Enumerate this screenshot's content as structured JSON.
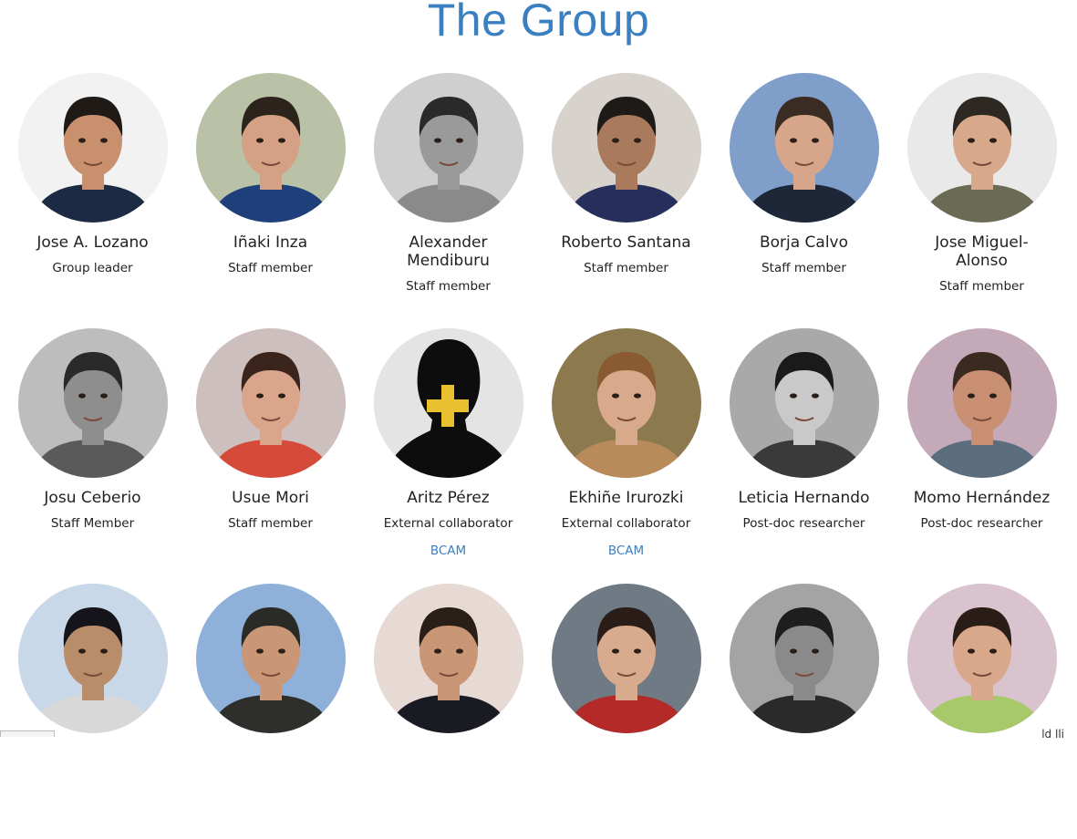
{
  "page": {
    "title": "The Group",
    "accent": "#3a7fc0"
  },
  "members": [
    {
      "name": "Jose A. Lozano",
      "role": "Group leader",
      "bg": "#f2f2f2",
      "skin": "#c9906e",
      "hair": "#1f1a16",
      "shirt": "#1d2a44"
    },
    {
      "name": "Iñaki Inza",
      "role": "Staff member",
      "bg": "#b9c2a6",
      "skin": "#d4a184",
      "hair": "#2c241c",
      "shirt": "#1f3f7a"
    },
    {
      "name": "Alexander Mendiburu",
      "role": "Staff member",
      "bg": "#cfcfcf",
      "skin": "#9a9a9a",
      "hair": "#2a2a2a",
      "shirt": "#8a8a8a"
    },
    {
      "name": "Roberto Santana",
      "role": "Staff member",
      "bg": "#d7d2cc",
      "skin": "#a97a5c",
      "hair": "#1d1a18",
      "shirt": "#262e5c"
    },
    {
      "name": "Borja Calvo",
      "role": "Staff member",
      "bg": "#7f9ec9",
      "skin": "#d6a58a",
      "hair": "#3a2c22",
      "shirt": "#1d2738"
    },
    {
      "name": "Jose Miguel-Alonso",
      "role": "Staff member",
      "bg": "#e9e9e9",
      "skin": "#d7a88a",
      "hair": "#2e2822",
      "shirt": "#6b6a55"
    },
    {
      "name": "Josu Ceberio",
      "role": "Staff Member",
      "bg": "#bdbdbd",
      "skin": "#8e8e8e",
      "hair": "#2a2a2a",
      "shirt": "#5a5a5a"
    },
    {
      "name": "Usue Mori",
      "role": "Staff member",
      "bg": "#cdbfbd",
      "skin": "#d9a68c",
      "hair": "#3b241b",
      "shirt": "#d64a3a"
    },
    {
      "name": "Aritz Pérez",
      "role": "External collaborator",
      "link": "BCAM",
      "placeholder": true,
      "bg": "#e4e4e4"
    },
    {
      "name": "Ekhiñe Irurozki",
      "role": "External collaborator",
      "link": "BCAM",
      "bg": "#8c7a4e",
      "skin": "#d8a98a",
      "hair": "#8a5a32",
      "shirt": "#b98a5a"
    },
    {
      "name": "Leticia Hernando",
      "role": "Post-doc researcher",
      "bg": "#a9a9a9",
      "skin": "#c9c9c9",
      "hair": "#1a1a1a",
      "shirt": "#3a3a3a"
    },
    {
      "name": "Momo Hernández",
      "role": "Post-doc researcher",
      "bg": "#c4a9b9",
      "skin": "#c98f72",
      "hair": "#3a2a20",
      "shirt": "#5c6e7e"
    },
    {
      "name": "",
      "role": "",
      "bg": "#c9d8e8",
      "skin": "#b98d6a",
      "hair": "#14141a",
      "shirt": "#d8d8d8"
    },
    {
      "name": "",
      "role": "",
      "bg": "#8fb0d8",
      "skin": "#c99676",
      "hair": "#2a2a26",
      "shirt": "#2e2e2a"
    },
    {
      "name": "",
      "role": "",
      "bg": "#e7d9d4",
      "skin": "#c99676",
      "hair": "#2a1e18",
      "shirt": "#1a1a22"
    },
    {
      "name": "",
      "role": "",
      "bg": "#6f7a84",
      "skin": "#d8ab8e",
      "hair": "#2a1d18",
      "shirt": "#b32a28"
    },
    {
      "name": "",
      "role": "",
      "bg": "#a4a4a4",
      "skin": "#8a8a8a",
      "hair": "#1e1e1e",
      "shirt": "#2a2a2a"
    },
    {
      "name": "",
      "role": "",
      "bg": "#d9c3cf",
      "skin": "#d9a88a",
      "hair": "#2a1d18",
      "shirt": "#a7c96a"
    }
  ],
  "footer": {
    "corner_text": "ld lli"
  }
}
